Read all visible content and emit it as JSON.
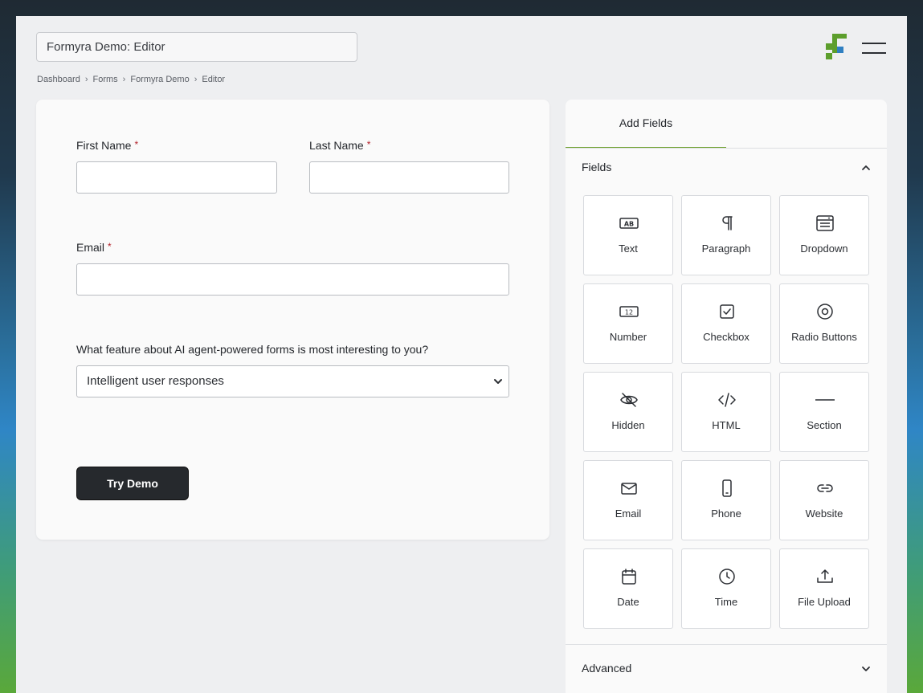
{
  "header": {
    "title_value": "Formyra Demo: Editor"
  },
  "breadcrumb": [
    "Dashboard",
    "Forms",
    "Formyra Demo",
    "Editor"
  ],
  "form": {
    "first_name_label": "First Name",
    "last_name_label": "Last Name",
    "email_label": "Email",
    "required_mark": "*",
    "question_label": "What feature about AI agent-powered forms is most interesting to you?",
    "question_selected": "Intelligent user responses",
    "submit_label": "Try Demo"
  },
  "panel": {
    "tab_label": "Add Fields",
    "fields_section_title": "Fields",
    "advanced_section_title": "Advanced",
    "tiles": [
      {
        "label": "Text",
        "icon": "text-icon"
      },
      {
        "label": "Paragraph",
        "icon": "paragraph-icon"
      },
      {
        "label": "Dropdown",
        "icon": "dropdown-icon"
      },
      {
        "label": "Number",
        "icon": "number-icon"
      },
      {
        "label": "Checkbox",
        "icon": "checkbox-icon"
      },
      {
        "label": "Radio Buttons",
        "icon": "radio-icon"
      },
      {
        "label": "Hidden",
        "icon": "hidden-icon"
      },
      {
        "label": "HTML",
        "icon": "html-icon"
      },
      {
        "label": "Section",
        "icon": "section-icon"
      },
      {
        "label": "Email",
        "icon": "email-icon"
      },
      {
        "label": "Phone",
        "icon": "phone-icon"
      },
      {
        "label": "Website",
        "icon": "link-icon"
      },
      {
        "label": "Date",
        "icon": "calendar-icon"
      },
      {
        "label": "Time",
        "icon": "clock-icon"
      },
      {
        "label": "File Upload",
        "icon": "upload-icon"
      }
    ]
  },
  "colors": {
    "accent": "#6ea12e",
    "button_dark": "#26292d",
    "required": "#b3222b",
    "logo_green": "#5c9e2c",
    "logo_blue": "#2f7fc1"
  }
}
